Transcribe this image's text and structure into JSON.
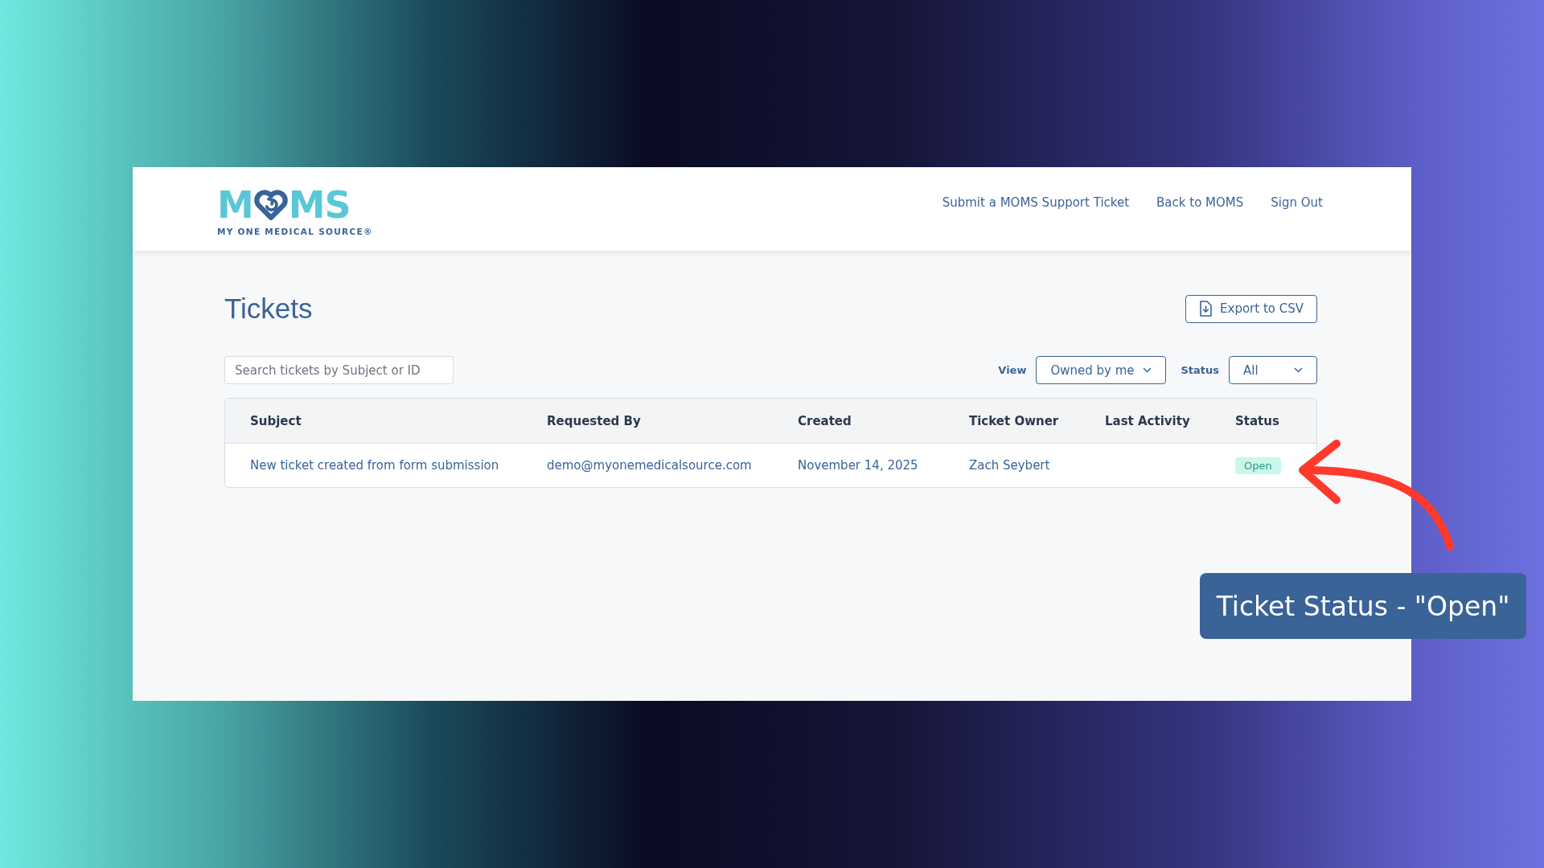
{
  "header": {
    "logo": {
      "left": "M",
      "right": "MS",
      "tagline": "MY ONE MEDICAL SOURCE®"
    },
    "nav": [
      "Submit a MOMS Support Ticket",
      "Back to MOMS",
      "Sign Out"
    ]
  },
  "page": {
    "title": "Tickets",
    "export_button": "Export to CSV",
    "search": {
      "placeholder": "Search tickets by Subject or ID"
    },
    "filters": [
      {
        "label": "View",
        "value": "Owned by me"
      },
      {
        "label": "Status",
        "value": "All"
      }
    ]
  },
  "table": {
    "columns": [
      "Subject",
      "Requested By",
      "Created",
      "Ticket Owner",
      "Last Activity",
      "Status"
    ],
    "rows": [
      {
        "subject": "New ticket created from form submission",
        "requested_by": "demo@myonemedicalsource.com",
        "created": "November 14, 2025",
        "owner": "Zach Seybert",
        "status": {
          "label": "Open",
          "kind": "open"
        }
      }
    ]
  },
  "annotation": {
    "text": "Ticket Status - \"Open\""
  }
}
